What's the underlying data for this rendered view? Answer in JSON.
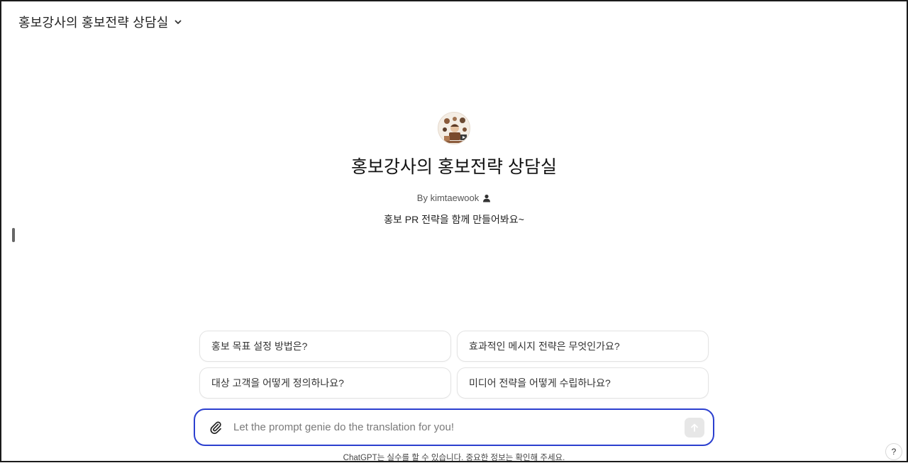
{
  "header": {
    "model_title": "홍보강사의 홍보전략 상담실",
    "chevron_icon": "chevron-down-icon"
  },
  "gizmo": {
    "avatar_icon": "gizmo-avatar-illustration",
    "title": "홍보강사의 홍보전략 상담실",
    "author": "By kimtaewook",
    "author_icon": "user-icon",
    "description": "홍보 PR 전략을 함께 만들어봐요~"
  },
  "starters": [
    {
      "label": "홍보 목표 설정 방법은?"
    },
    {
      "label": "효과적인 메시지 전략은 무엇인가요?"
    },
    {
      "label": "대상 고객을 어떻게 정의하나요?"
    },
    {
      "label": "미디어 전략을 어떻게 수립하나요?"
    }
  ],
  "composer": {
    "placeholder": "Let the prompt genie do the translation for you!",
    "value": "",
    "attach_icon": "paperclip-icon",
    "send_icon": "arrow-up-icon",
    "border_color": "#2b3fcf"
  },
  "footer": {
    "disclaimer": "ChatGPT는 실수를 할 수 있습니다. 중요한 정보는 확인해 주세요.",
    "help_label": "?"
  }
}
